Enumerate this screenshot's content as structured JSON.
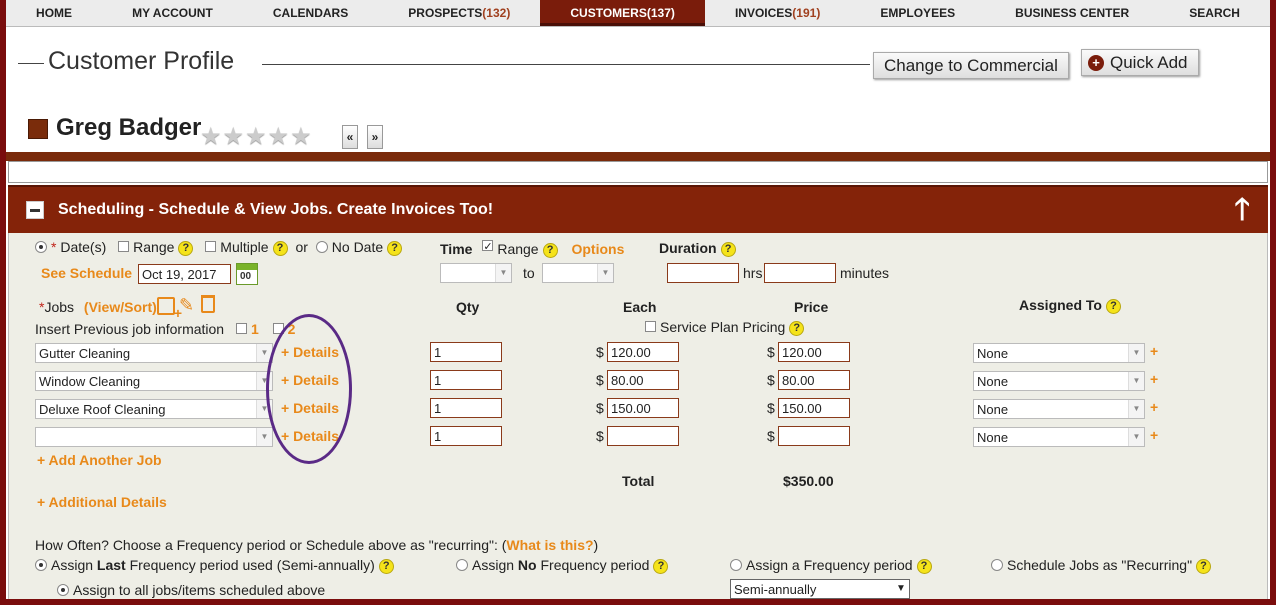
{
  "nav": {
    "items": [
      {
        "label": "HOME",
        "count": ""
      },
      {
        "label": "MY ACCOUNT",
        "count": ""
      },
      {
        "label": "CALENDARS",
        "count": ""
      },
      {
        "label": "PROSPECTS",
        "count": "(132)"
      },
      {
        "label": "CUSTOMERS",
        "count": "(137)"
      },
      {
        "label": "INVOICES",
        "count": "(191)"
      },
      {
        "label": "EMPLOYEES",
        "count": ""
      },
      {
        "label": "BUSINESS CENTER",
        "count": ""
      },
      {
        "label": "SEARCH",
        "count": ""
      }
    ]
  },
  "header": {
    "title": "Customer Profile",
    "commercial_button": "Change to Commercial",
    "quick_add_button": "Quick Add",
    "quick_add_icon": "+"
  },
  "customer": {
    "name": "Greg Badger",
    "stars": "★★★★★",
    "prev": "«",
    "next": "»"
  },
  "section": {
    "title": "Scheduling - Schedule & View Jobs. Create Invoices Too!",
    "collapse_icon": "minus-icon",
    "up_icon": "🡑"
  },
  "schedule": {
    "req_mark": "*",
    "dates_label": "Date(s)",
    "range_label": "Range",
    "multiple_label": "Multiple",
    "or_label": "or",
    "no_date_label": "No Date",
    "see_schedule": "See Schedule",
    "date_value": "Oct 19, 2017",
    "calendar_text": "00",
    "time_label": "Time",
    "time_range_label": "Range",
    "options_label": "Options",
    "to_label": "to",
    "duration_label": "Duration",
    "hrs_label": "hrs",
    "minutes_label": "minutes",
    "help": "?"
  },
  "jobs": {
    "label": "Jobs",
    "view_sort": "(View/Sort)",
    "insert_prev": "Insert Previous job information",
    "insert_opt1": "1",
    "insert_opt2": "2",
    "col_qty": "Qty",
    "col_each": "Each",
    "col_price": "Price",
    "col_assigned": "Assigned To",
    "service_plan": "Service Plan Pricing",
    "details_label": "+ Details",
    "currency": "$",
    "rows": [
      {
        "job": "Gutter Cleaning",
        "qty": "1",
        "each": "120.00",
        "price": "120.00",
        "assigned": "None"
      },
      {
        "job": "Window Cleaning",
        "qty": "1",
        "each": "80.00",
        "price": "80.00",
        "assigned": "None"
      },
      {
        "job": "Deluxe Roof Cleaning",
        "qty": "1",
        "each": "150.00",
        "price": "150.00",
        "assigned": "None"
      },
      {
        "job": "",
        "qty": "1",
        "each": "",
        "price": "",
        "assigned": "None"
      }
    ],
    "add_another": "+ Add Another Job",
    "additional_details": "+ Additional Details",
    "total_label": "Total",
    "total_value": "$350.00",
    "plus": "+"
  },
  "frequency": {
    "question": "How Often? Choose a Frequency period or Schedule above as \"recurring\": (",
    "what_is_this": "What is this?",
    "close_paren": ")",
    "opt_last_pre": "Assign ",
    "opt_last_bold": "Last",
    "opt_last_post": " Frequency period used (Semi-annually)",
    "opt_no_pre": "Assign ",
    "opt_no_bold": "No",
    "opt_no_post": " Frequency period",
    "opt_assign": "Assign a Frequency period",
    "opt_recurring": "Schedule Jobs as \"Recurring\"",
    "assign_all": "Assign to all jobs/items scheduled above",
    "period_value": "Semi-annually",
    "caret": "▼"
  }
}
